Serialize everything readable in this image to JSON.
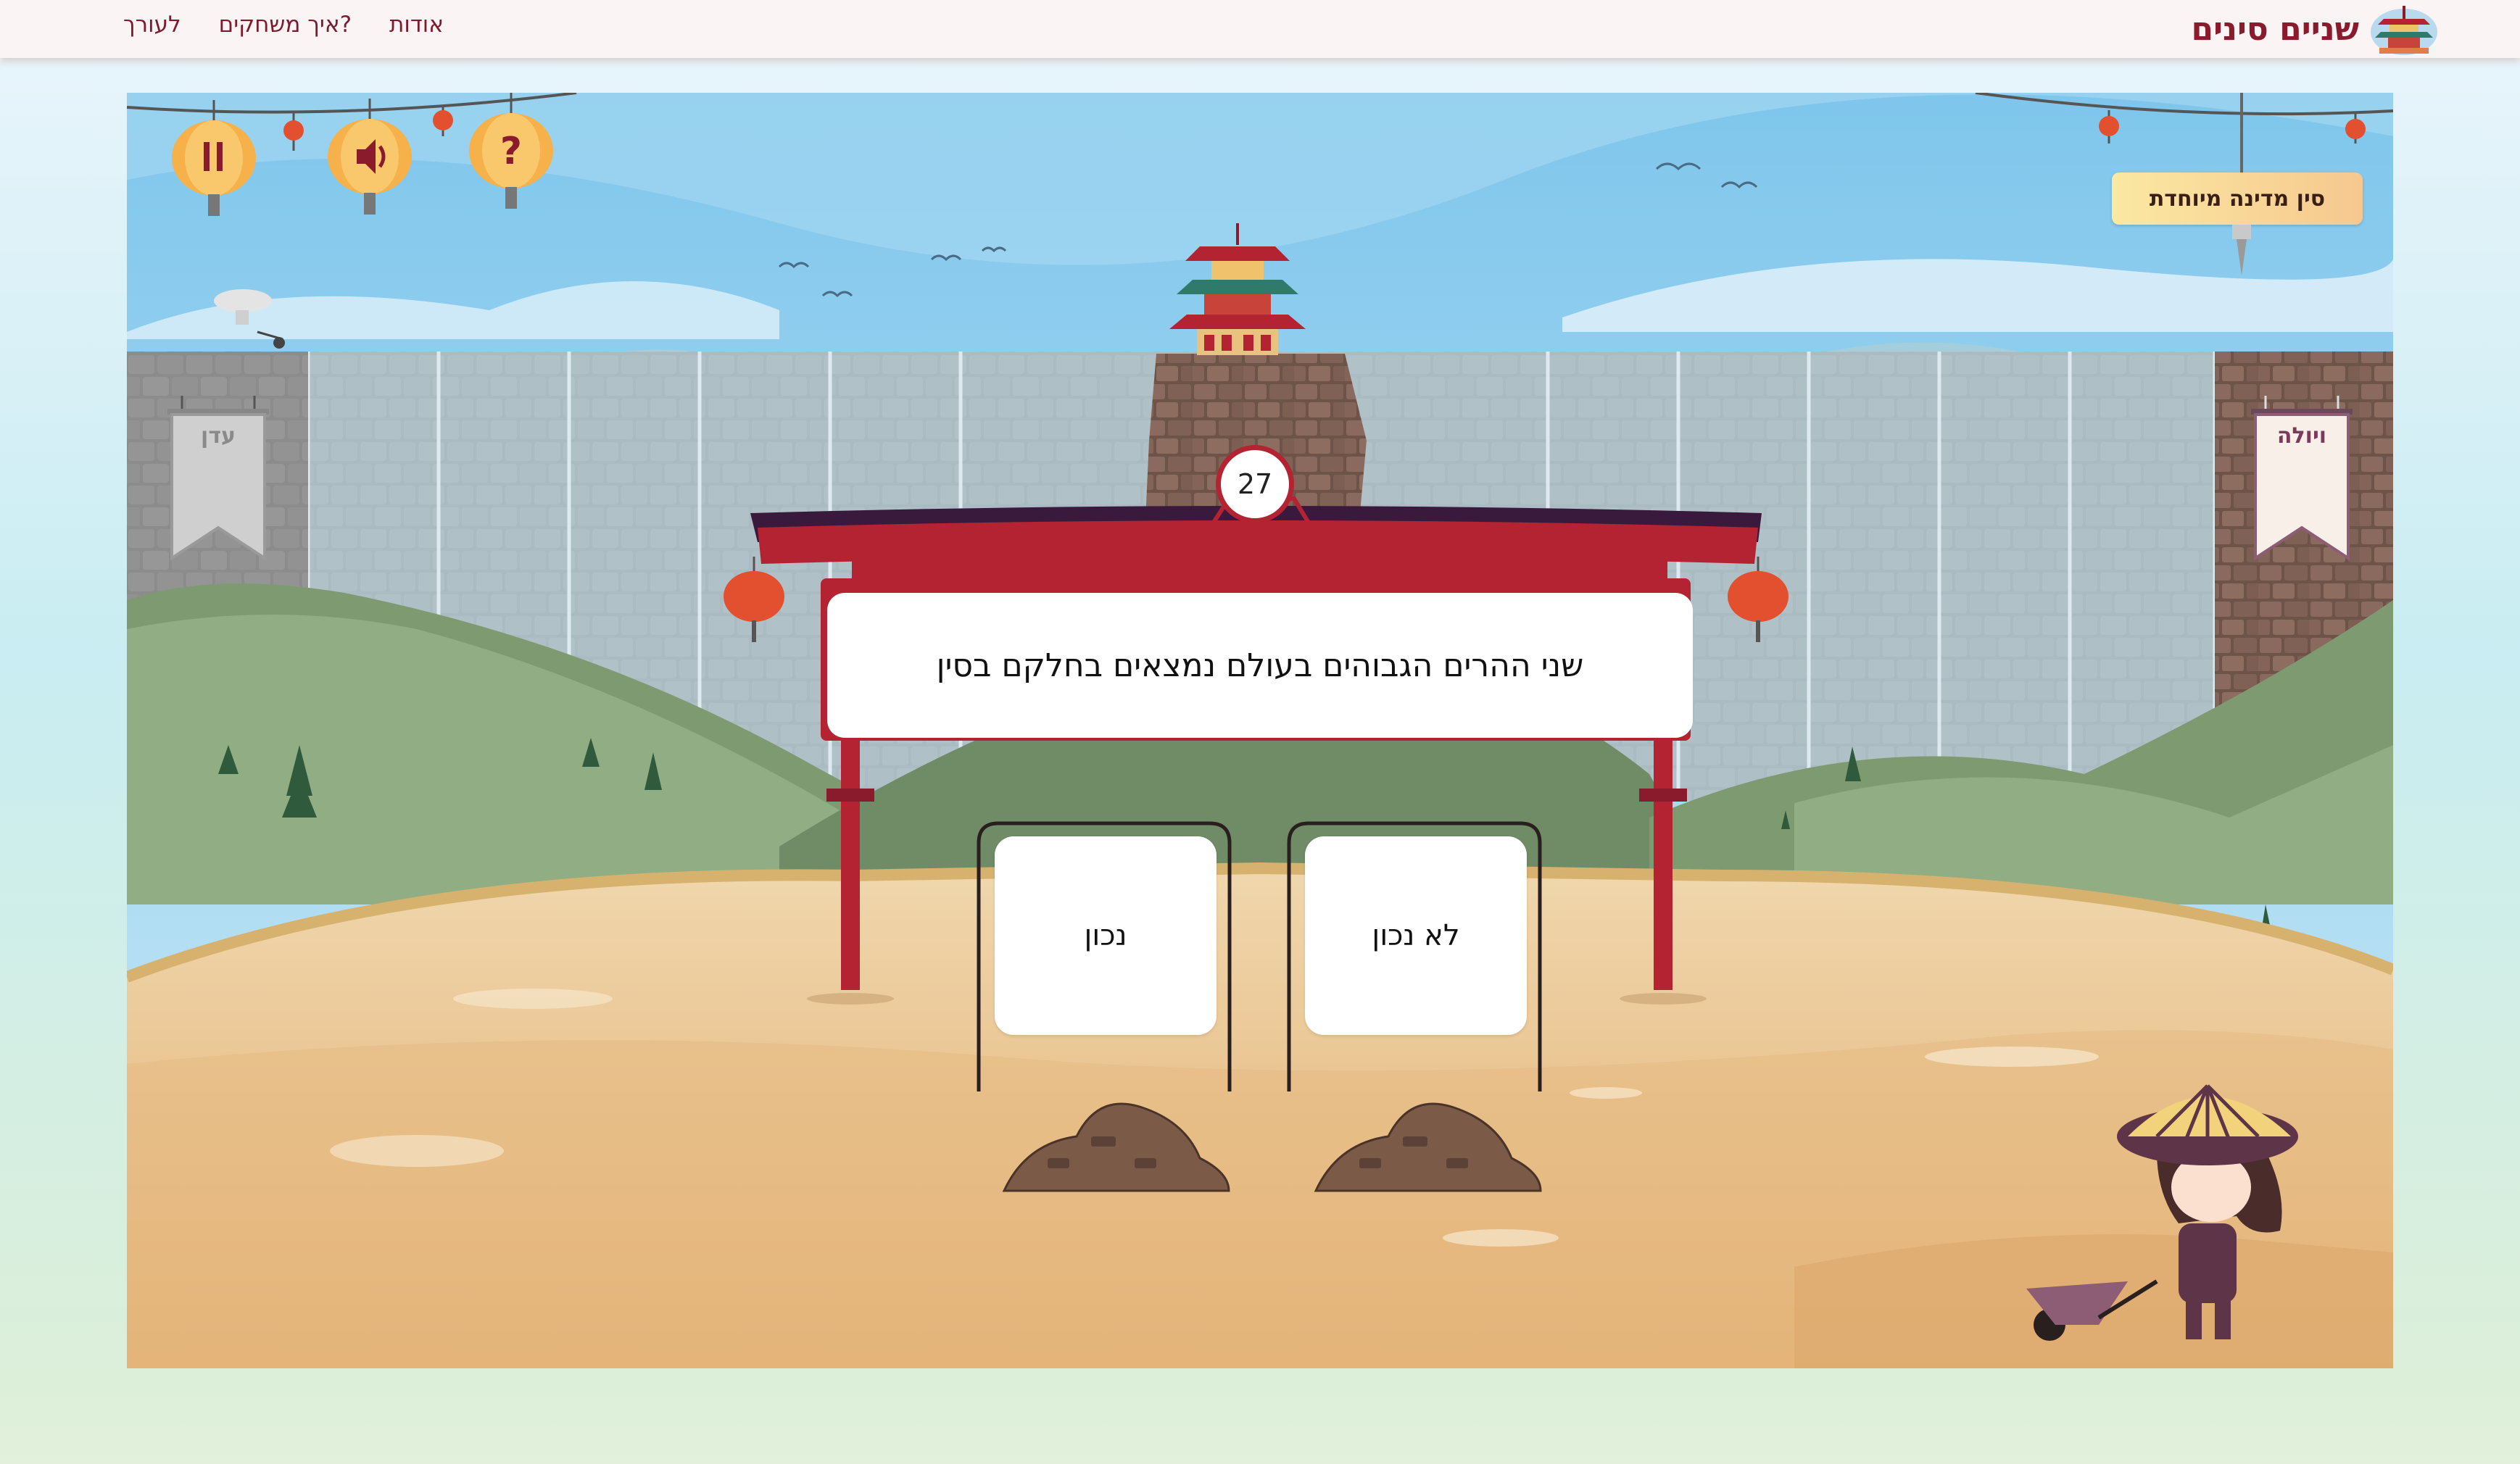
{
  "nav": {
    "links": [
      {
        "label": "לעורך"
      },
      {
        "label": "איך משחקים?"
      },
      {
        "label": "אודות"
      }
    ],
    "brand_title": "שניים סינים"
  },
  "game": {
    "controls": [
      {
        "name": "pause-button",
        "icon": "pause-icon"
      },
      {
        "name": "sound-button",
        "icon": "speaker-icon"
      },
      {
        "name": "help-button",
        "icon": "question-icon"
      }
    ],
    "special_label": "סין מדינה מיוחדת",
    "left_player": "עדן",
    "right_player": "ויולה",
    "question_number": "27",
    "question_text": "שני ההרים הגבוהים בעולם נמצאים בחלקם בסין",
    "answers": [
      {
        "label": "נכון"
      },
      {
        "label": "לא נכון"
      }
    ]
  },
  "colors": {
    "brand": "#8a1b2c",
    "gate_red": "#b42331",
    "sky": "#8fd0ef",
    "ground": "#e3b983",
    "badge": "#f9d99a"
  }
}
